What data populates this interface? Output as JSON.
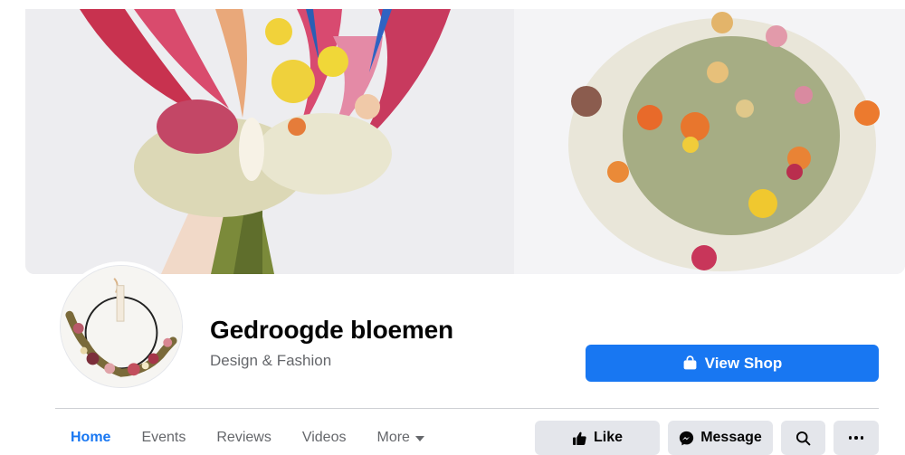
{
  "page": {
    "name": "Gedroogde bloemen",
    "category": "Design & Fashion"
  },
  "actions": {
    "view_shop_label": "View Shop",
    "like_label": "Like",
    "message_label": "Message"
  },
  "tabs": [
    {
      "label": "Home",
      "active": true
    },
    {
      "label": "Events",
      "active": false
    },
    {
      "label": "Reviews",
      "active": false
    },
    {
      "label": "Videos",
      "active": false
    },
    {
      "label": "More",
      "active": false
    }
  ],
  "colors": {
    "accent": "#1877f2",
    "secondary_button": "#e4e6eb",
    "muted_text": "#65676b"
  },
  "icons": [
    "shopping-bag-icon",
    "thumbs-up-icon",
    "messenger-icon",
    "search-icon",
    "more-dots-icon",
    "caret-down-icon"
  ]
}
